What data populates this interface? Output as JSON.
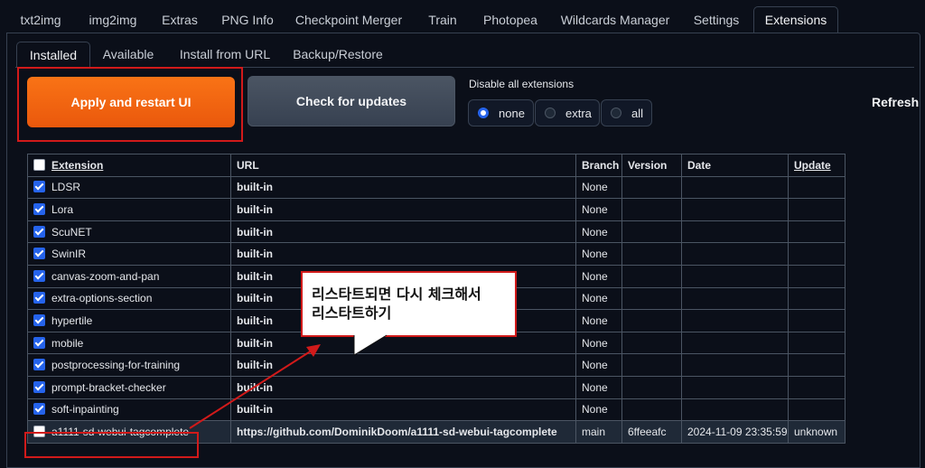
{
  "top_tabs": [
    "txt2img",
    "img2img",
    "Extras",
    "PNG Info",
    "Checkpoint Merger",
    "Train",
    "Photopea",
    "Wildcards Manager",
    "Settings",
    "Extensions"
  ],
  "sub_tabs": [
    "Installed",
    "Available",
    "Install from URL",
    "Backup/Restore"
  ],
  "buttons": {
    "apply": "Apply and restart UI",
    "check": "Check for updates",
    "refresh": "Refresh"
  },
  "disable": {
    "label": "Disable all extensions",
    "options": [
      "none",
      "extra",
      "all"
    ],
    "selected": "none"
  },
  "table": {
    "headers": [
      "Extension",
      "URL",
      "Branch",
      "Version",
      "Date",
      "Update"
    ],
    "rows": [
      {
        "name": "LDSR",
        "url": "built-in",
        "branch": "None",
        "version": "",
        "date": "",
        "update": "",
        "checked": true
      },
      {
        "name": "Lora",
        "url": "built-in",
        "branch": "None",
        "version": "",
        "date": "",
        "update": "",
        "checked": true
      },
      {
        "name": "ScuNET",
        "url": "built-in",
        "branch": "None",
        "version": "",
        "date": "",
        "update": "",
        "checked": true
      },
      {
        "name": "SwinIR",
        "url": "built-in",
        "branch": "None",
        "version": "",
        "date": "",
        "update": "",
        "checked": true
      },
      {
        "name": "canvas-zoom-and-pan",
        "url": "built-in",
        "branch": "None",
        "version": "",
        "date": "",
        "update": "",
        "checked": true
      },
      {
        "name": "extra-options-section",
        "url": "built-in",
        "branch": "None",
        "version": "",
        "date": "",
        "update": "",
        "checked": true
      },
      {
        "name": "hypertile",
        "url": "built-in",
        "branch": "None",
        "version": "",
        "date": "",
        "update": "",
        "checked": true
      },
      {
        "name": "mobile",
        "url": "built-in",
        "branch": "None",
        "version": "",
        "date": "",
        "update": "",
        "checked": true
      },
      {
        "name": "postprocessing-for-training",
        "url": "built-in",
        "branch": "None",
        "version": "",
        "date": "",
        "update": "",
        "checked": true
      },
      {
        "name": "prompt-bracket-checker",
        "url": "built-in",
        "branch": "None",
        "version": "",
        "date": "",
        "update": "",
        "checked": true
      },
      {
        "name": "soft-inpainting",
        "url": "built-in",
        "branch": "None",
        "version": "",
        "date": "",
        "update": "",
        "checked": true
      },
      {
        "name": "a1111-sd-webui-tagcomplete",
        "url": "https://github.com/DominikDoom/a1111-sd-webui-tagcomplete",
        "branch": "main",
        "version": "6ffeeafc",
        "date": "2024-11-09 23:35:59",
        "update": "unknown",
        "checked": false
      }
    ]
  },
  "callout": {
    "line1": "리스타트되면 다시 체크해서",
    "line2": "리스타트하기"
  },
  "colors": {
    "accent_orange": "#f97316",
    "annotation_red": "#d11a1a",
    "checkbox_blue": "#2563eb",
    "background": "#0b0f19"
  }
}
